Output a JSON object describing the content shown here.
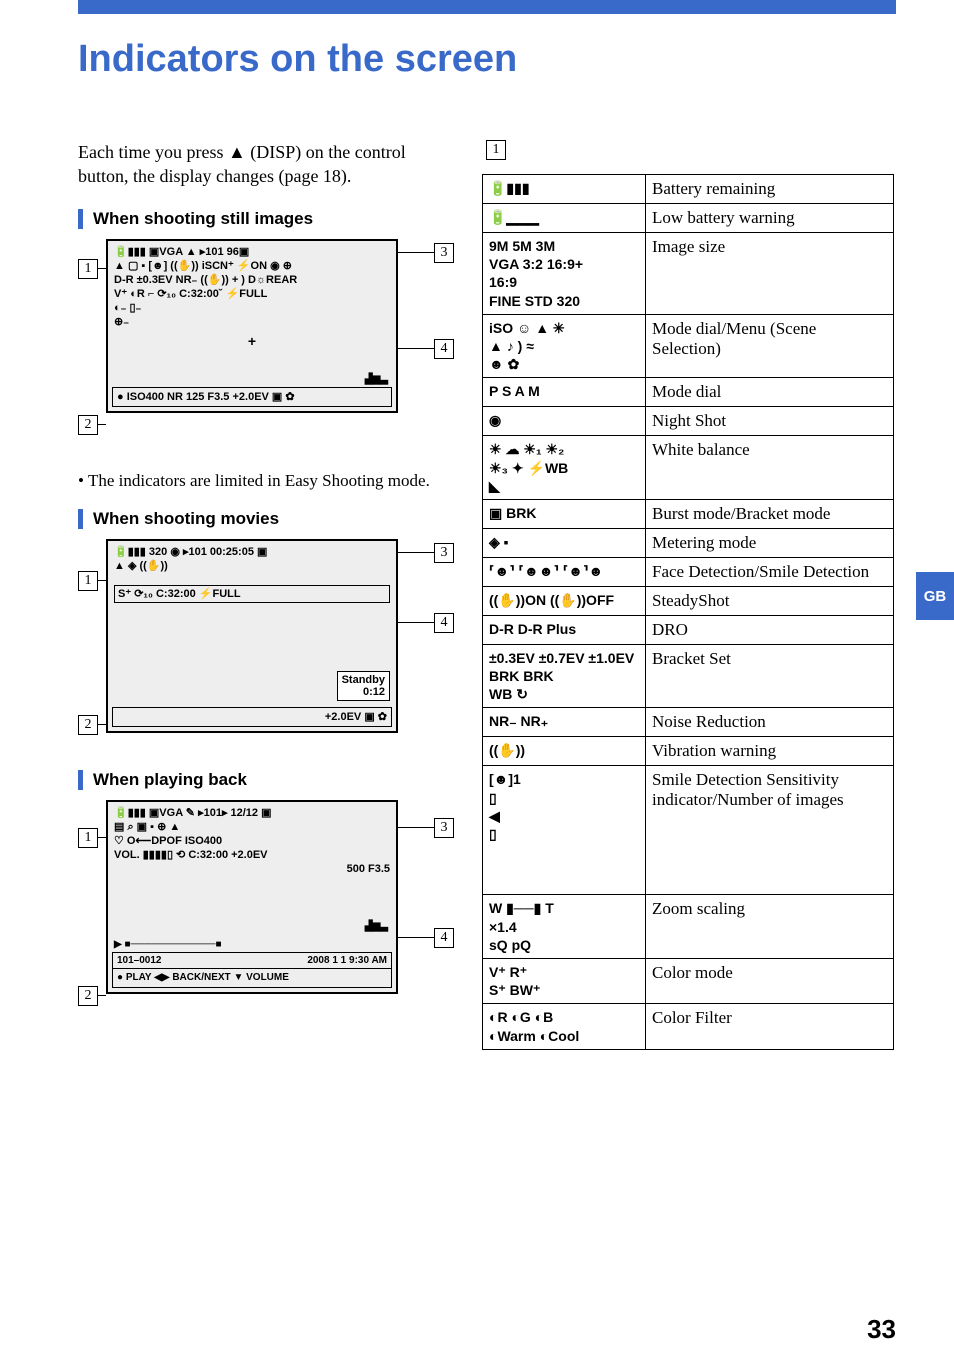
{
  "title": "Indicators on the screen",
  "intro": "Each time you press ▲ (DISP) on the control button, the display changes (page 18).",
  "headings": {
    "still": "When shooting still images",
    "movies": "When shooting movies",
    "playback": "When playing back"
  },
  "note_still": "The indicators are limited in Easy Shooting mode.",
  "callouts": {
    "one": "1",
    "two": "2",
    "three": "3",
    "four": "4"
  },
  "group_number": "1",
  "table1": [
    {
      "icon": "🔋▮▮▮",
      "desc": "Battery remaining"
    },
    {
      "icon": "🔋▁▁▁",
      "desc": "Low battery warning"
    },
    {
      "icon": "9M 5M 3M\nVGA 3:2 16:9+\n16:9\nFINE STD 320",
      "desc": "Image size"
    },
    {
      "icon": "iSO ☺ ▲ ✳\n▲ ♪ ) ≈\n☻ ✿",
      "desc": "Mode dial/Menu (Scene Selection)"
    },
    {
      "icon": "P S A M",
      "desc": "Mode dial"
    },
    {
      "icon": "◉",
      "desc": "Night Shot"
    },
    {
      "icon": "☀ ☁ ☀₁ ☀₂\n☀₃ ✦ ⚡WB\n◣",
      "desc": "White balance"
    },
    {
      "icon": "▣ BRK",
      "desc": "Burst mode/Bracket mode"
    },
    {
      "icon": "◈  ▪",
      "desc": "Metering mode"
    },
    {
      "icon": "⸢☻⸣ ⸢☻☻⸣ ⸢☻⸣☻",
      "desc": "Face Detection/Smile Detection"
    },
    {
      "icon": "((✋))ON ((✋))OFF",
      "desc": "SteadyShot"
    },
    {
      "icon": "D-R  D-R Plus",
      "desc": "DRO"
    },
    {
      "icon": "±0.3EV ±0.7EV ±1.0EV\nBRK BRK\nWB ↻",
      "desc": "Bracket Set"
    },
    {
      "icon": "NR₋ NR₊",
      "desc": "Noise Reduction"
    },
    {
      "icon": "((✋))",
      "desc": "Vibration warning"
    },
    {
      "icon": "[☻]1\n▯\n◀\n▯",
      "desc": "Smile Detection Sensitivity indicator/Number of images"
    },
    {
      "icon": "W ▮──▮ T\n×1.4\nsQ pQ",
      "desc": "Zoom scaling"
    },
    {
      "icon": "V⁺ R⁺\nS⁺ BW⁺",
      "desc": "Color mode"
    },
    {
      "icon": "◐R ◐G ◐B\n◐Warm ◐Cool",
      "desc": "Color Filter"
    }
  ],
  "diagram_still": {
    "top_row": "🔋▮▮▮     ▣VGA ▲  ▸101        96▣",
    "r2": "▲ ▢ ▪ [☻]     ((✋))  iSCN⁺  ⚡ON ◉ ⊕",
    "r3": "D-R ±0.3EV NR₋     ((✋))  +  )        D☼REAR",
    "r4": "V⁺ ◐R    ⌐         ⟳₁₀ C:32:00˘      ⚡FULL",
    "r5": "◐₋ ▯₋",
    "r6": "⊕₋",
    "cross": "+",
    "histo": "▟▆▃",
    "bottom": "● ISO400  NR  125  F3.5  +2.0EV  ▣ ✿"
  },
  "diagram_movies": {
    "top_row": "🔋▮▮▮     320 ◉  ▸101    00:25:05 ▣",
    "r2": "▲     ◈         ((✋))",
    "r3": "S⁺           ⟳₁₀ C:32:00        ⚡FULL",
    "standby1": "Standby",
    "standby2": "   0:12",
    "bottom": "                +2.0EV  ▣ ✿"
  },
  "diagram_playback": {
    "top_row": "🔋▮▮▮     ▣VGA ✎  ▸101▸     12/12 ▣",
    "r2": "▤ ⌕             ▣          ▪ ⊕ ▲",
    "r3": "♡ O⟵DPOF                    ISO400",
    "r4": "VOL. ▮▮▮▮▯   ⟲ C:32:00   +2.0EV",
    "r5": "                            500 F3.5",
    "histo": "▟▆▃",
    "prog": "▶  ■────────────■",
    "footer_left": "101–0012",
    "footer_right": "2008  1  1   9:30 AM",
    "play_controls": "● PLAY     ◀▶ BACK/NEXT     ▼ VOLUME"
  },
  "side_tab": "GB",
  "page_number": "33"
}
